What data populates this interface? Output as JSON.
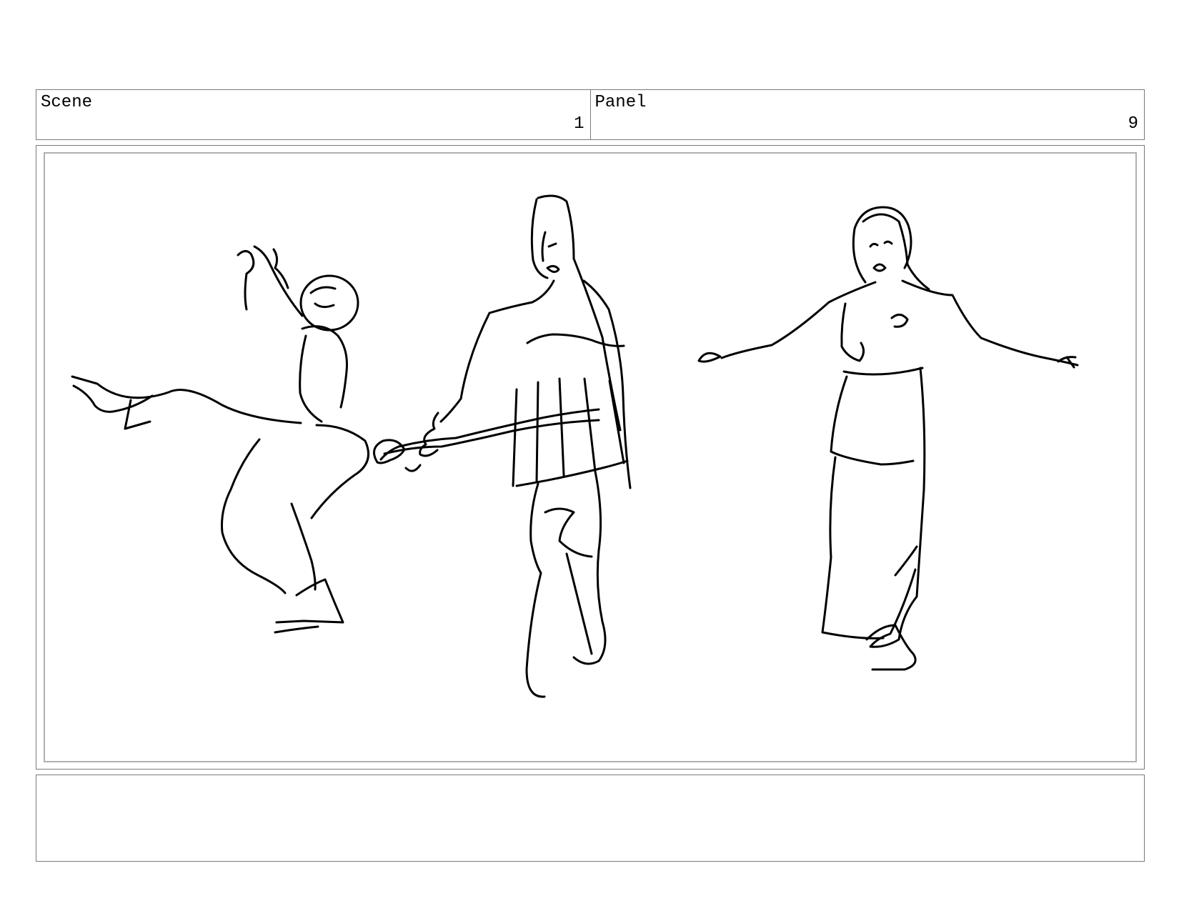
{
  "header": {
    "scene_label": "Scene",
    "scene_value": "1",
    "panel_label": "Panel",
    "panel_value": "9"
  },
  "panel": {
    "image_description": ""
  },
  "notes": {
    "text": ""
  }
}
